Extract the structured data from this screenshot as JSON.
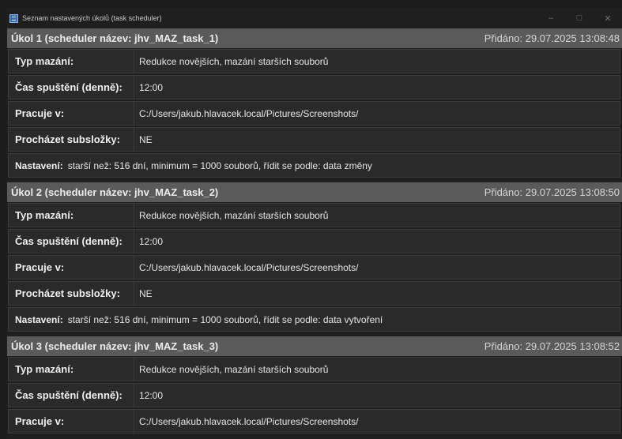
{
  "window": {
    "title": "Seznam nastavených úkolů (task scheduler)",
    "minimize_glyph": "–",
    "maximize_glyph": "□",
    "close_glyph": "✕"
  },
  "labels": {
    "delete_type": "Typ mazání:",
    "run_time": "Čas spuštění (denně):",
    "works_in": "Pracuje v:",
    "browse_subfolders": "Procházet subsložky:",
    "settings": "Nastavení:"
  },
  "tasks": [
    {
      "header_title": "Úkol 1 (scheduler název: jhv_MAZ_task_1)",
      "header_added": "Přidáno: 29.07.2025 13:08:48",
      "delete_type": "Redukce novějších, mazání starších souborů",
      "run_time": "12:00",
      "works_in": "C:/Users/jakub.hlavacek.local/Pictures/Screenshots/",
      "browse_subfolders": "NE",
      "settings": "starší než: 516 dní, minimum = 1000 souborů, řídit se podle: data změny"
    },
    {
      "header_title": "Úkol 2 (scheduler název: jhv_MAZ_task_2)",
      "header_added": "Přidáno: 29.07.2025 13:08:50",
      "delete_type": "Redukce novějších, mazání starších souborů",
      "run_time": "12:00",
      "works_in": "C:/Users/jakub.hlavacek.local/Pictures/Screenshots/",
      "browse_subfolders": "NE",
      "settings": "starší než: 516 dní, minimum = 1000 souborů, řídit se podle: data vytvoření"
    },
    {
      "header_title": "Úkol 3 (scheduler název: jhv_MAZ_task_3)",
      "header_added": "Přidáno: 29.07.2025 13:08:52",
      "delete_type": "Redukce novějších, mazání starších souborů",
      "run_time": "12:00",
      "works_in": "C:/Users/jakub.hlavacek.local/Pictures/Screenshots/"
    }
  ]
}
